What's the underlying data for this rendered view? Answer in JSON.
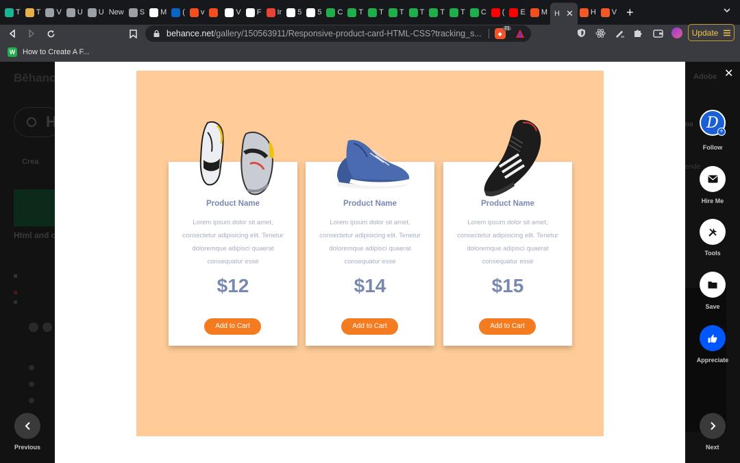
{
  "browser": {
    "tabs": [
      {
        "label": "T",
        "color": "#1ab394",
        "icon": "diamond-icon"
      },
      {
        "label": "T",
        "color": "#e8b04a",
        "icon": "cup-icon"
      },
      {
        "label": "V",
        "color": "#9aa0a6",
        "icon": "globe-icon"
      },
      {
        "label": "U",
        "color": "#9aa0a6",
        "icon": "globe-icon"
      },
      {
        "label": "U",
        "color": "#9aa0a6",
        "icon": "globe-icon"
      },
      {
        "label": "New",
        "color": "",
        "icon": ""
      },
      {
        "label": "S",
        "color": "#9aa0a6",
        "icon": "gear-icon"
      },
      {
        "label": "M",
        "color": "#ffffff",
        "icon": "google-icon"
      },
      {
        "label": "(",
        "color": "#0a66c2",
        "icon": "linkedin-icon"
      },
      {
        "label": "v",
        "color": "#f24e1e",
        "icon": "figma-icon"
      },
      {
        "label": "",
        "color": "#f24e1e",
        "icon": "figma-icon"
      },
      {
        "label": "V",
        "color": "#ffffff",
        "icon": "a-icon"
      },
      {
        "label": "F",
        "color": "#ffffff",
        "icon": "github-icon"
      },
      {
        "label": "Ir",
        "color": "#ea4335",
        "icon": "gmail-icon"
      },
      {
        "label": "5",
        "color": "#ffffff",
        "icon": "triangle-icon"
      },
      {
        "label": "5",
        "color": "#ffffff",
        "icon": "triangle-icon"
      },
      {
        "label": "C",
        "color": "#1fae4b",
        "icon": "w-icon"
      },
      {
        "label": "T",
        "color": "#1fae4b",
        "icon": "w-icon"
      },
      {
        "label": "T",
        "color": "#1fae4b",
        "icon": "w-icon"
      },
      {
        "label": "T",
        "color": "#1fae4b",
        "icon": "w-icon"
      },
      {
        "label": "T",
        "color": "#1fae4b",
        "icon": "w-icon"
      },
      {
        "label": "T",
        "color": "#1fae4b",
        "icon": "w-icon"
      },
      {
        "label": "T",
        "color": "#1fae4b",
        "icon": "w-icon"
      },
      {
        "label": "C",
        "color": "#1fae4b",
        "icon": "w-icon"
      },
      {
        "label": "(",
        "color": "#ff0000",
        "icon": "youtube-icon"
      },
      {
        "label": "E",
        "color": "#ff0000",
        "icon": "youtube-icon"
      },
      {
        "label": "M",
        "color": "#f24e1e",
        "icon": "figma-icon"
      }
    ],
    "active_tab": {
      "label": "H",
      "close": "✕"
    },
    "trailing_tabs": [
      {
        "label": "H",
        "color": "#f15a24",
        "icon": "wave-icon"
      },
      {
        "label": "V",
        "color": "#f15a24",
        "icon": "wave-icon"
      }
    ],
    "new_tab": "+",
    "url": {
      "host": "behance.net",
      "path": "/gallery/150563911/Responsive-product-card-HTML-CSS?tracking_s..."
    },
    "brave_badge": "21",
    "update_label": "Update",
    "bookmark": {
      "label": "How to Create A F...",
      "icon": "cup-bookmark-icon"
    }
  },
  "background_page": {
    "logo": "Bēhance",
    "adobe": "Adobe",
    "search_letter": "H",
    "create_label": "Crea",
    "project_title": "Html and c",
    "right_partial": "oa",
    "right_partial2": "ende"
  },
  "product_cards": [
    {
      "name": "Product Name",
      "desc": "Lorem ipsum dolor sit amet, consectetur adipisicing elit. Tenetur doloremque adipisci quaerat consequatur esse",
      "price": "$12",
      "cta": "Add to Cart",
      "shoe": "sneaker-pair-image"
    },
    {
      "name": "Product Name",
      "desc": "Lorem ipsum dolor sit amet, consectetur adipisicing elit. Tenetur doloremque adipisci quaerat consequatur esse",
      "price": "$14",
      "cta": "Add to Cart",
      "shoe": "blue-canvas-shoe-image"
    },
    {
      "name": "Product Name",
      "desc": "Lorem ipsum dolor sit amet, consectetur adipisicing elit. Tenetur doloremque adipisci quaerat consequatur esse",
      "price": "$15",
      "cta": "Add to Cart",
      "shoe": "black-sneaker-image"
    }
  ],
  "rail": {
    "follow": "Follow",
    "hire": "Hire Me",
    "tools": "Tools",
    "save": "Save",
    "appreciate": "Appreciate",
    "avatar_letter": "D"
  },
  "nav": {
    "previous": "Previous",
    "next": "Next",
    "close": "✕"
  },
  "colors": {
    "page_bg": "#ffcc99",
    "accent": "#f47b20",
    "appreciate": "#0057ff",
    "title_blue": "#7888b0"
  }
}
